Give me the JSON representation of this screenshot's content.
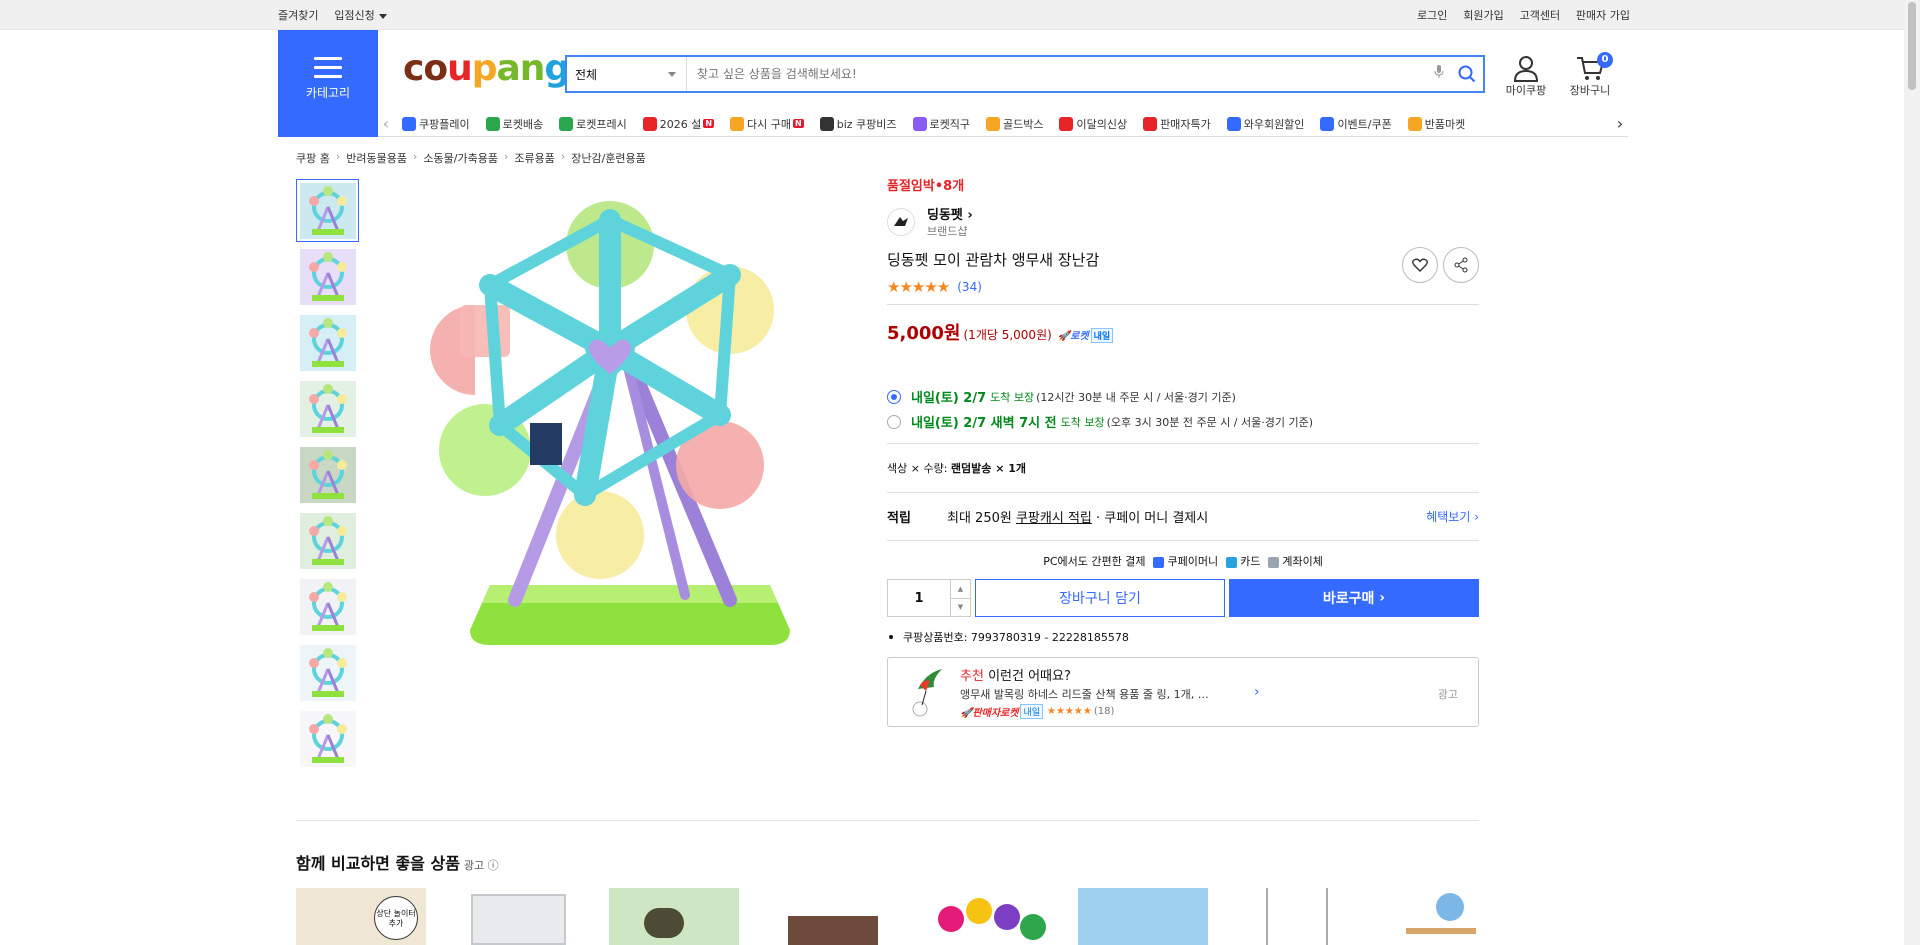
{
  "topbar": {
    "left": [
      "즐겨찾기",
      "입점신청"
    ],
    "right": [
      "로그인",
      "회원가입",
      "고객센터",
      "판매자 가입"
    ]
  },
  "header": {
    "category_label": "카테고리",
    "logo_parts": [
      "co",
      "u",
      "p",
      "an",
      "g"
    ],
    "search": {
      "category": "전체",
      "placeholder": "찾고 싶은 상품을 검색해보세요!"
    },
    "mycoupang_label": "마이쿠팡",
    "cart_label": "장바구니",
    "cart_count": "0"
  },
  "nav": {
    "items": [
      {
        "label": "쿠팡플레이",
        "color": "#346aff",
        "new": false
      },
      {
        "label": "로켓배송",
        "color": "#2aa84f",
        "new": false
      },
      {
        "label": "로켓프레시",
        "color": "#2aa84f",
        "new": false
      },
      {
        "label": "2026 설",
        "color": "#e52528",
        "new": true
      },
      {
        "label": "다시 구매",
        "color": "#f6a623",
        "new": true
      },
      {
        "label": "biz 쿠팡비즈",
        "color": "#333333",
        "new": false
      },
      {
        "label": "로켓직구",
        "color": "#8a5cf6",
        "new": false
      },
      {
        "label": "골드박스",
        "color": "#f6a623",
        "new": false
      },
      {
        "label": "이달의신상",
        "color": "#e52528",
        "new": false
      },
      {
        "label": "판매자특가",
        "color": "#e52528",
        "new": false
      },
      {
        "label": "와우회원할인",
        "color": "#346aff",
        "new": false
      },
      {
        "label": "이벤트/쿠폰",
        "color": "#346aff",
        "new": false
      },
      {
        "label": "반품마켓",
        "color": "#f6a623",
        "new": false
      }
    ]
  },
  "breadcrumb": [
    "쿠팡 홈",
    "반려동물용품",
    "소동물/가축용품",
    "조류용품",
    "장난감/훈련용품"
  ],
  "product": {
    "low_stock": "품절임박•8개",
    "brand_name": "딩동펫",
    "brand_sub": "브랜드샵",
    "title": "딩동펫 모이 관람차 앵무새 장난감",
    "rating": 4.5,
    "stars": "★★★★★",
    "review_count": "(34)",
    "price": "5,000원",
    "unit_price": "(1개당 5,000원)",
    "rocket_label": "로켓",
    "rocket_tag": "내일",
    "delivery_options": [
      {
        "title": "내일(토) 2/7",
        "guarantee": "도착 보장",
        "note": "(12시간 30분 내 주문 시 / 서울·경기 기준)",
        "selected": true
      },
      {
        "title": "내일(토) 2/7 새벽 7시 전",
        "guarantee": "도착 보장",
        "note": "(오후 3시 30분 전 주문 시 / 서울·경기 기준)",
        "selected": false
      }
    ],
    "option_line_prefix": "색상 × 수량:",
    "option_line_value": "랜덤발송 × 1개",
    "cash_label": "적립",
    "cash_text_pre": "최대 250원",
    "cash_link": "쿠팡캐시 적립",
    "cash_text_post": "· 쿠페이 머니 결제시",
    "benefit_link": "혜택보기",
    "pay_title": "PC에서도 간편한 결제",
    "pay_methods": [
      {
        "label": "쿠페이머니",
        "color": "#346aff"
      },
      {
        "label": "카드",
        "color": "#29a3e0"
      },
      {
        "label": "계좌이체",
        "color": "#9aa4b1"
      }
    ],
    "quantity": "1",
    "add_cart": "장바구니 담기",
    "buy_now": "바로구매",
    "product_id": "쿠팡상품번호: 7993780319 - 22228185578"
  },
  "recommend": {
    "label_red": "추천",
    "label": "이런건 어때요?",
    "desc": "앵무새 발목링 하네스 리드줄 산책 용품 줄 링, 1개, …",
    "seller": "판매자로켓",
    "seller_tag": "내일",
    "stars": "★★★★★",
    "count": "(18)",
    "ad": "광고"
  },
  "section": {
    "title": "함께 비교하면 좋을 상품",
    "ad": "광고 ⓘ",
    "card_badge": "상단 놀이터 추가"
  },
  "colors": {
    "accent": "#346aff",
    "price": "#ae0000",
    "rocket_green": "#00891a"
  }
}
